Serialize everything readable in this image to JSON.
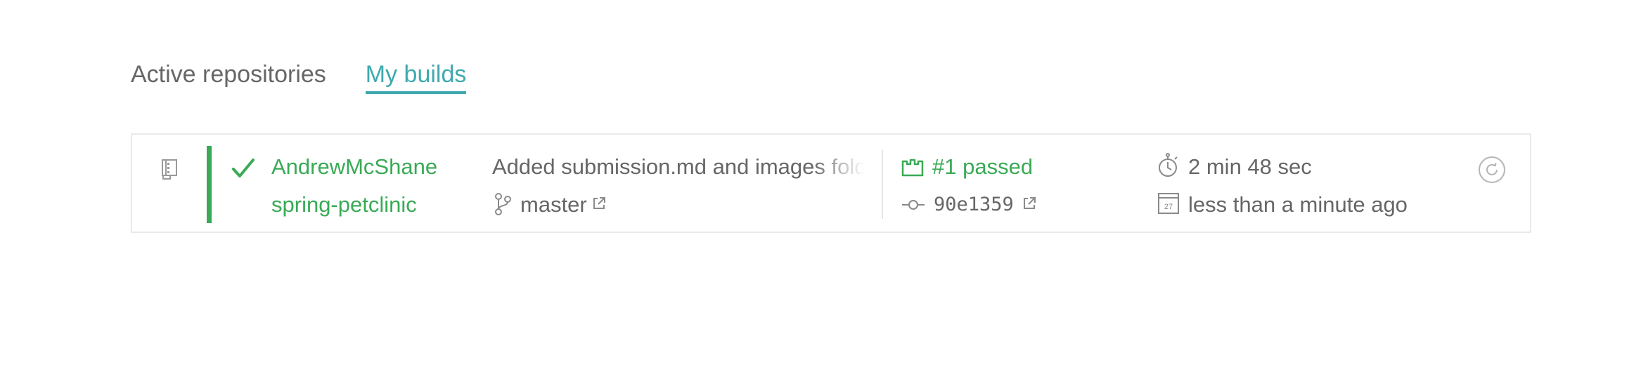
{
  "tabs": [
    {
      "label": "Active repositories",
      "active": false
    },
    {
      "label": "My builds",
      "active": true
    }
  ],
  "build": {
    "owner": "AndrewMcShane",
    "repository": "spring-petclinic",
    "commit_message": "Added submission.md and images folder",
    "branch": "master",
    "status": "#1 passed",
    "commit_sha": "90e1359",
    "duration": "2 min 48 sec",
    "finished": "less than a minute ago",
    "calendar_day": "27"
  },
  "colors": {
    "accent": "#3eaaaf",
    "passed": "#39aa56",
    "text": "#666666",
    "border": "#eaeaea"
  },
  "icons": [
    "repo-icon",
    "check-icon",
    "branch-icon",
    "external-link-icon",
    "passed-icon",
    "commit-icon",
    "stopwatch-icon",
    "calendar-icon",
    "restart-icon"
  ]
}
